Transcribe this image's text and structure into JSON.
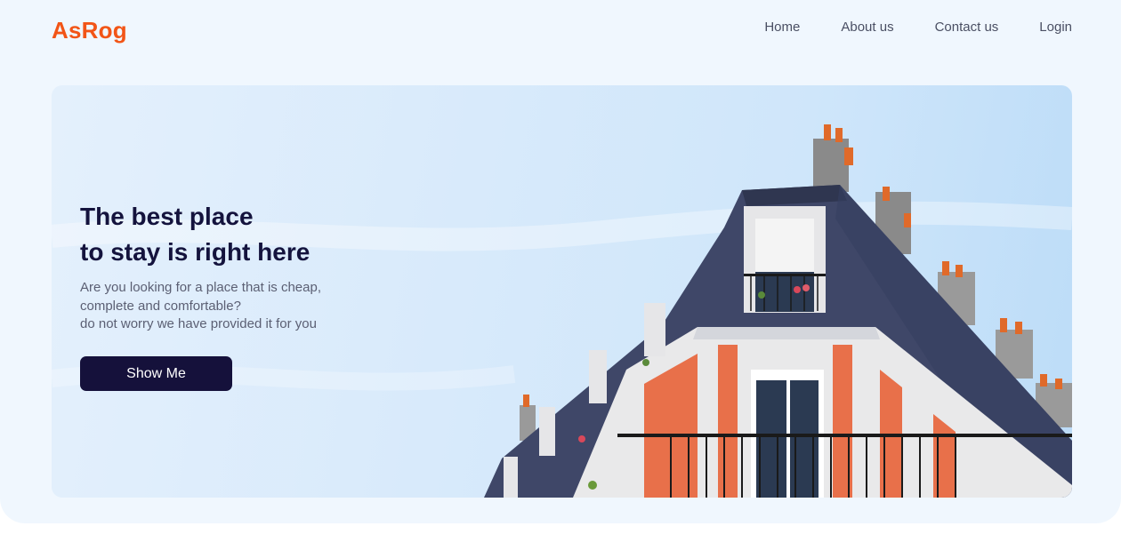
{
  "brand": {
    "name": "AsRog"
  },
  "nav": {
    "items": [
      "Home",
      "About us",
      "Contact us",
      "Login"
    ]
  },
  "hero": {
    "title_line1": "The best place",
    "title_line2": "to stay is right here",
    "desc_line1": "Are you looking for a place that is cheap,",
    "desc_line2": "complete and comfortable?",
    "desc_line3": "do not worry we have provided it for you",
    "cta_label": "Show Me",
    "image_icon": "building-photo-icon"
  },
  "colors": {
    "brand": "#f25517",
    "dark": "#15113b",
    "page_bg": "#f0f7fe",
    "roof": "#3f4768",
    "brick": "#e8704a"
  }
}
